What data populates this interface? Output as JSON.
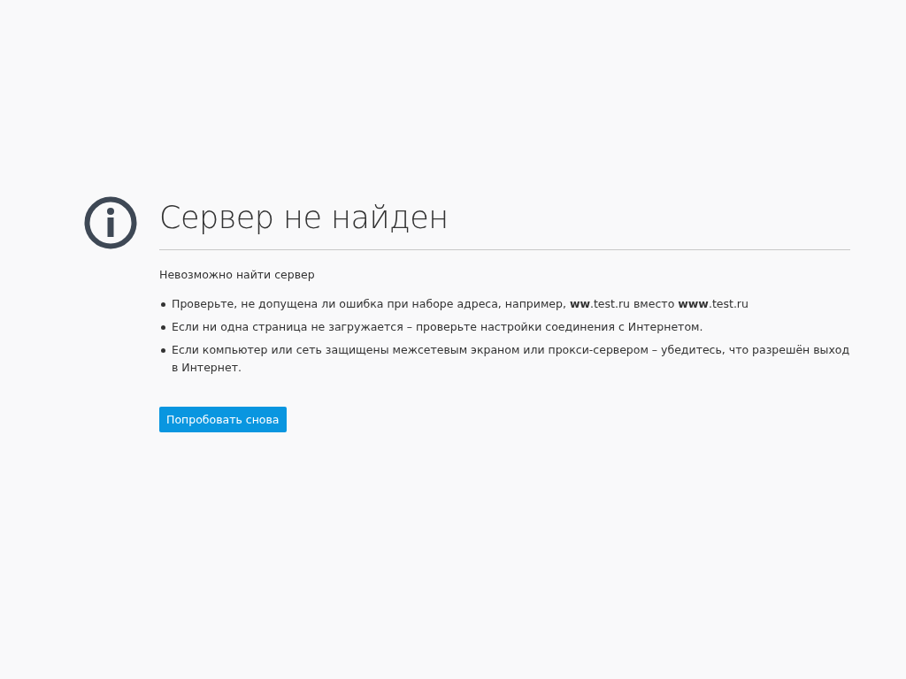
{
  "title": "Сервер не найден",
  "subtitle": "Невозможно найти сервер",
  "tips": [
    "Проверьте, не допущена ли ошибка при наборе адреса, например, **ww**.test.ru вместо **www**.test.ru",
    "Если ни одна страница не загружается – проверьте настройки соединения с Интернетом.",
    "Если компьютер или сеть защищены межсетевым экраном или прокси-сервером – убедитесь, что разрешён выход в Интернет."
  ],
  "button": "Попробовать снова"
}
